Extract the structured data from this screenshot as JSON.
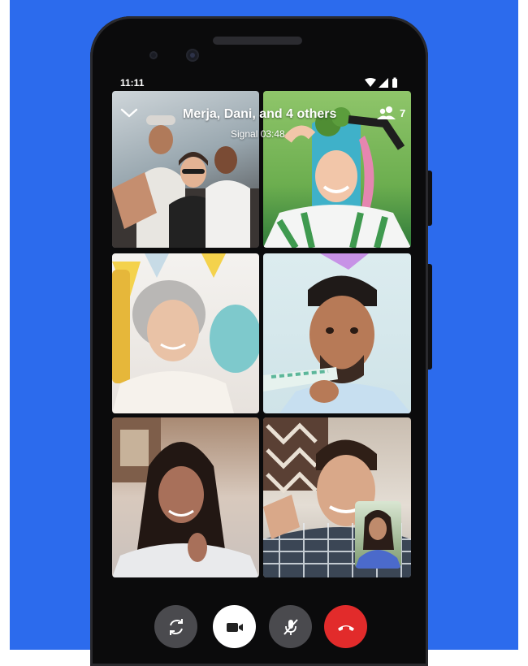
{
  "status_bar": {
    "time": "11:11"
  },
  "call_header": {
    "title": "Merja, Dani, and 4 others",
    "subtitle": "Signal 03:48",
    "participants_count": "7"
  },
  "colors": {
    "background_blue": "#2c6bed",
    "end_call_red": "#e22b2b",
    "control_gray": "#4a4a4e"
  },
  "controls": [
    {
      "name": "switch-camera",
      "icon": "flip-camera-icon"
    },
    {
      "name": "video-toggle",
      "icon": "video-camera-icon",
      "active": true
    },
    {
      "name": "mute-toggle",
      "icon": "mic-off-icon"
    },
    {
      "name": "end-call",
      "icon": "hang-up-icon"
    }
  ]
}
